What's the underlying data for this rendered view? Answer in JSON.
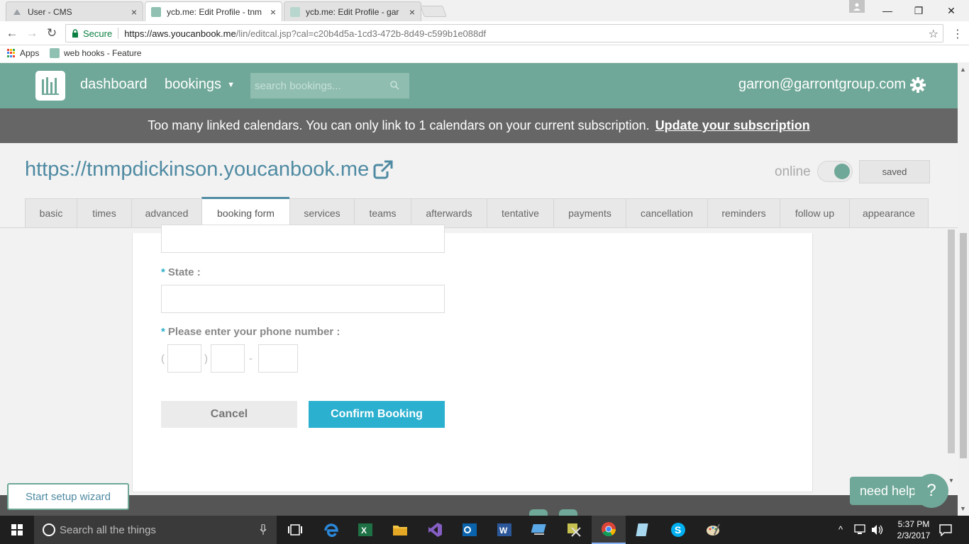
{
  "browser": {
    "tabs": [
      {
        "label": "User - CMS",
        "close": "×"
      },
      {
        "label": "ycb.me: Edit Profile - tnm",
        "close": "×"
      },
      {
        "label": "ycb.me: Edit Profile - gar",
        "close": "×"
      }
    ],
    "window_controls": {
      "minimize": "—",
      "maximize": "❐",
      "close": "✕"
    },
    "nav": {
      "back": "←",
      "forward": "→",
      "reload": "↻"
    },
    "address": {
      "secure_label": "Secure",
      "url_host": "https://aws.youcanbook.me",
      "url_path": "/lin/editcal.jsp?cal=c20b4d5a-1cd3-472b-8d49-c599b1e088df",
      "star": "☆",
      "menu": "⋮"
    },
    "bookmarks": [
      {
        "label": "Apps"
      },
      {
        "label": "web hooks - Feature"
      }
    ]
  },
  "app": {
    "nav": {
      "dashboard": "dashboard",
      "bookings": "bookings",
      "caret": "▼"
    },
    "search": {
      "placeholder": "search bookings..."
    },
    "account": "garron@garrontgroup.com",
    "banner": {
      "message": "Too many linked calendars. You can only link to 1 calendars on your current subscription.",
      "link": "Update your subscription"
    },
    "profile_url": "https://tnmpdickinson.youcanbook.me",
    "status": {
      "online_label": "online",
      "saved_label": "saved"
    },
    "tabs": [
      {
        "label": "basic"
      },
      {
        "label": "times"
      },
      {
        "label": "advanced"
      },
      {
        "label": "booking form"
      },
      {
        "label": "services"
      },
      {
        "label": "teams"
      },
      {
        "label": "afterwards"
      },
      {
        "label": "tentative"
      },
      {
        "label": "payments"
      },
      {
        "label": "cancellation"
      },
      {
        "label": "reminders"
      },
      {
        "label": "follow up"
      },
      {
        "label": "appearance"
      }
    ],
    "active_tab": "booking form",
    "form": {
      "required_mark": "*",
      "state_label": "State :",
      "phone_label": "Please enter your phone number :",
      "phone_open": "(",
      "phone_close": ")",
      "phone_dash": "-",
      "cancel": "Cancel",
      "confirm": "Confirm Booking"
    },
    "wizard": "Start setup wizard",
    "help": {
      "label": "need help",
      "icon": "?"
    }
  },
  "taskbar": {
    "search_placeholder": "Search all the things",
    "time": "5:37 PM",
    "date": "2/3/2017",
    "tray_caret": "^"
  },
  "colors": {
    "brand": "#6fa898",
    "accent": "#2cb0d0",
    "link": "#4e8aa2",
    "banner": "#666666"
  }
}
